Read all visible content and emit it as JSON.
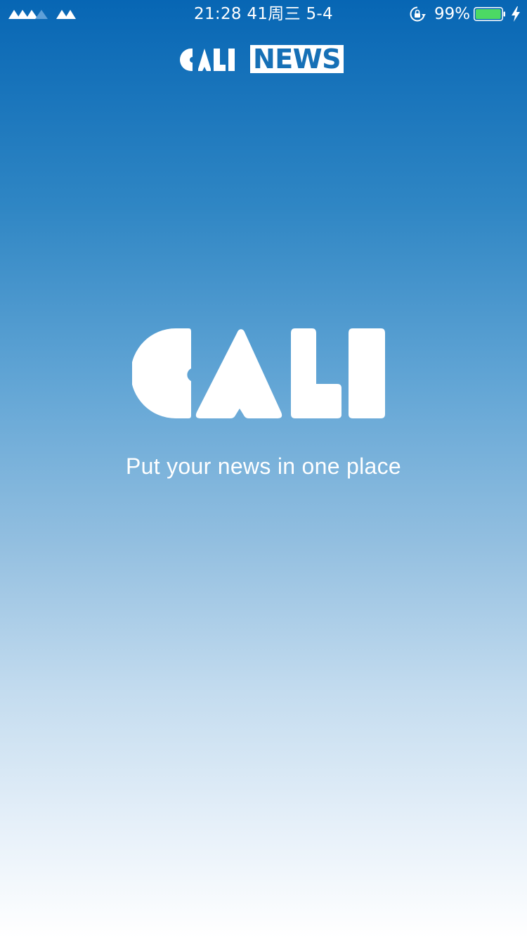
{
  "status_bar": {
    "time_text": "21:28 41周三 5-4",
    "battery_percent": "99%",
    "battery_level": 0.99,
    "signal_icon": "signal-icon",
    "rotation_lock_icon": "rotation-lock-icon",
    "charging_icon": "charging-bolt-icon",
    "battery_color": "#4cd964"
  },
  "header": {
    "logo_mark_text": "CALI",
    "logo_box_text": "NEWS",
    "box_text_color": "#1670b6"
  },
  "main": {
    "logo_text": "CALI",
    "tagline": "Put your news in one place"
  },
  "theme": {
    "gradient_top": "#0766b4",
    "gradient_bottom": "#ffffff"
  }
}
